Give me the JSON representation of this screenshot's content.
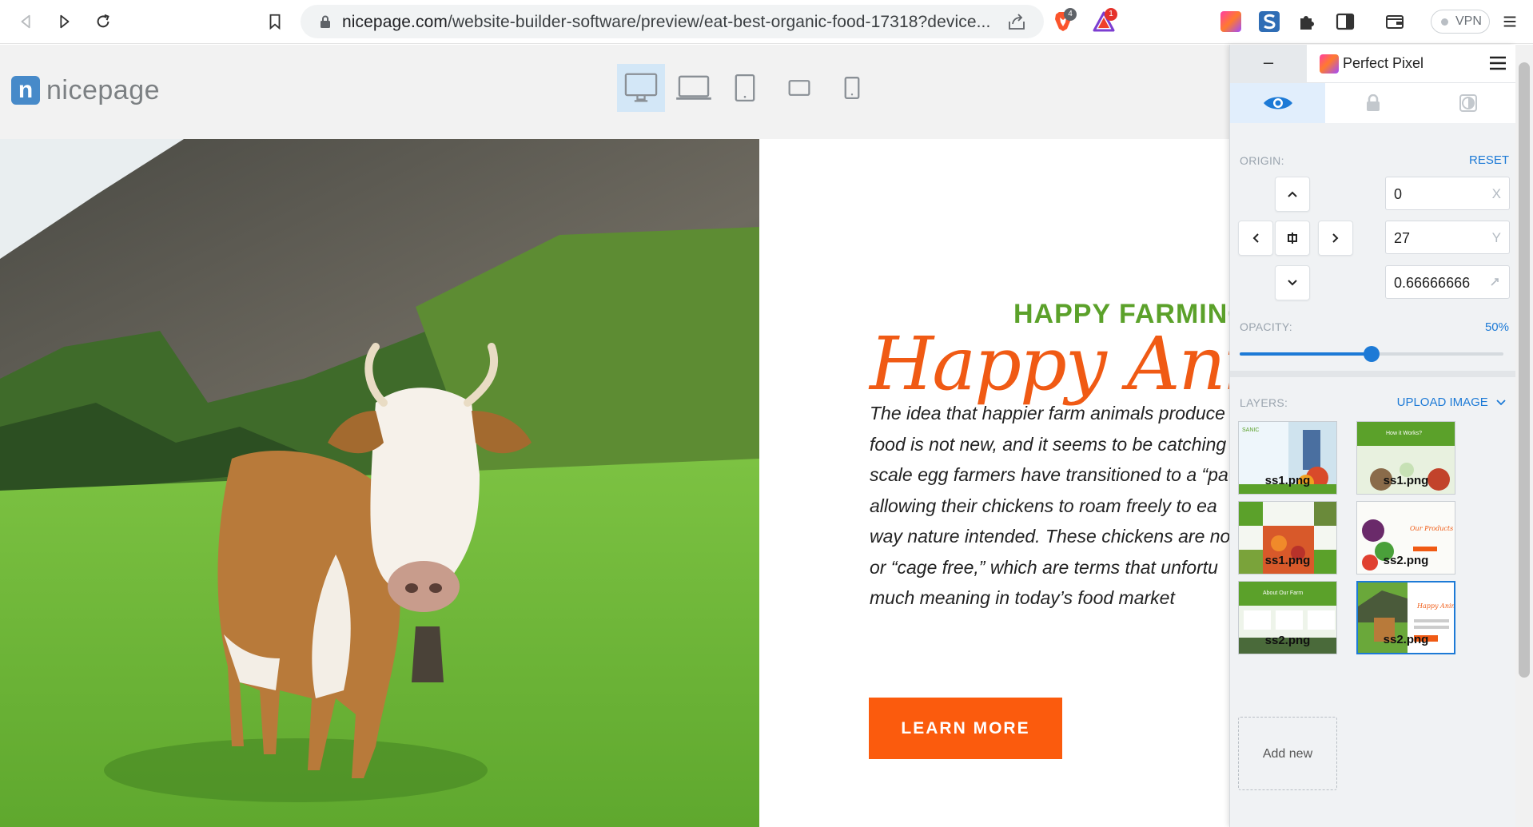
{
  "browser": {
    "url_host": "nicepage.com",
    "url_path": "/website-builder-software/preview/eat-best-organic-food-17318?device...",
    "brave_badge": "4",
    "alert_badge": "1",
    "vpn_label": "VPN",
    "icons": [
      "back-icon",
      "forward-icon",
      "reload-icon",
      "bookmark-icon",
      "lock-icon",
      "share-icon",
      "brave-shields-icon",
      "brave-rewards-icon",
      "perfect-pixel-extension-icon",
      "s-extension-icon",
      "puzzle-icon",
      "sidebar-icon",
      "wallet-icon",
      "menu-icon"
    ]
  },
  "nicepage": {
    "logo_text": "nicepage",
    "logo_mark": "n",
    "devices": [
      "desktop",
      "laptop",
      "tablet",
      "tablet-landscape",
      "phone"
    ],
    "active_device": "desktop"
  },
  "hero": {
    "kicker": "HAPPY FARMING",
    "script_title": "Happy Animals",
    "paragraph_lines": [
      "The idea that happier farm animals produce",
      "food is not new, and it seems to be catching",
      "scale egg farmers have transitioned to a “pa",
      "allowing their chickens to roam freely to ea",
      "way nature intended. These chickens are no",
      "or “cage free,” which are terms that unfortu",
      "much meaning in today’s food market"
    ],
    "button": "LEARN MORE",
    "accent_green": "#5ba12a",
    "accent_orange": "#fb5b0d"
  },
  "perfect_pixel": {
    "minimize_label": "–",
    "title": "Perfect Pixel",
    "origin_label": "ORIGIN:",
    "reset_label": "RESET",
    "x_value": "0",
    "x_unit": "X",
    "y_value": "27",
    "y_unit": "Y",
    "scale_value": "0.66666666",
    "opacity_label": "OPACITY:",
    "opacity_value": "50%",
    "opacity_fraction": 0.5,
    "layers_label": "LAYERS:",
    "upload_label": "UPLOAD IMAGE",
    "layers": [
      {
        "name": "ss1.png",
        "thumb": "organic",
        "title": "SANIC"
      },
      {
        "name": "ss1.png",
        "thumb": "how-it-works",
        "title": "How it Works?"
      },
      {
        "name": "ss1.png",
        "thumb": "produce-grid",
        "title": ""
      },
      {
        "name": "ss2.png",
        "thumb": "our-products",
        "title": "Our Products"
      },
      {
        "name": "ss2.png",
        "thumb": "about-farm",
        "title": "About Our Farm"
      },
      {
        "name": "ss2.png",
        "thumb": "happy-animals",
        "title": "Happy Animals"
      }
    ],
    "add_new_label": "Add new",
    "accent": "#1d7ad6"
  }
}
